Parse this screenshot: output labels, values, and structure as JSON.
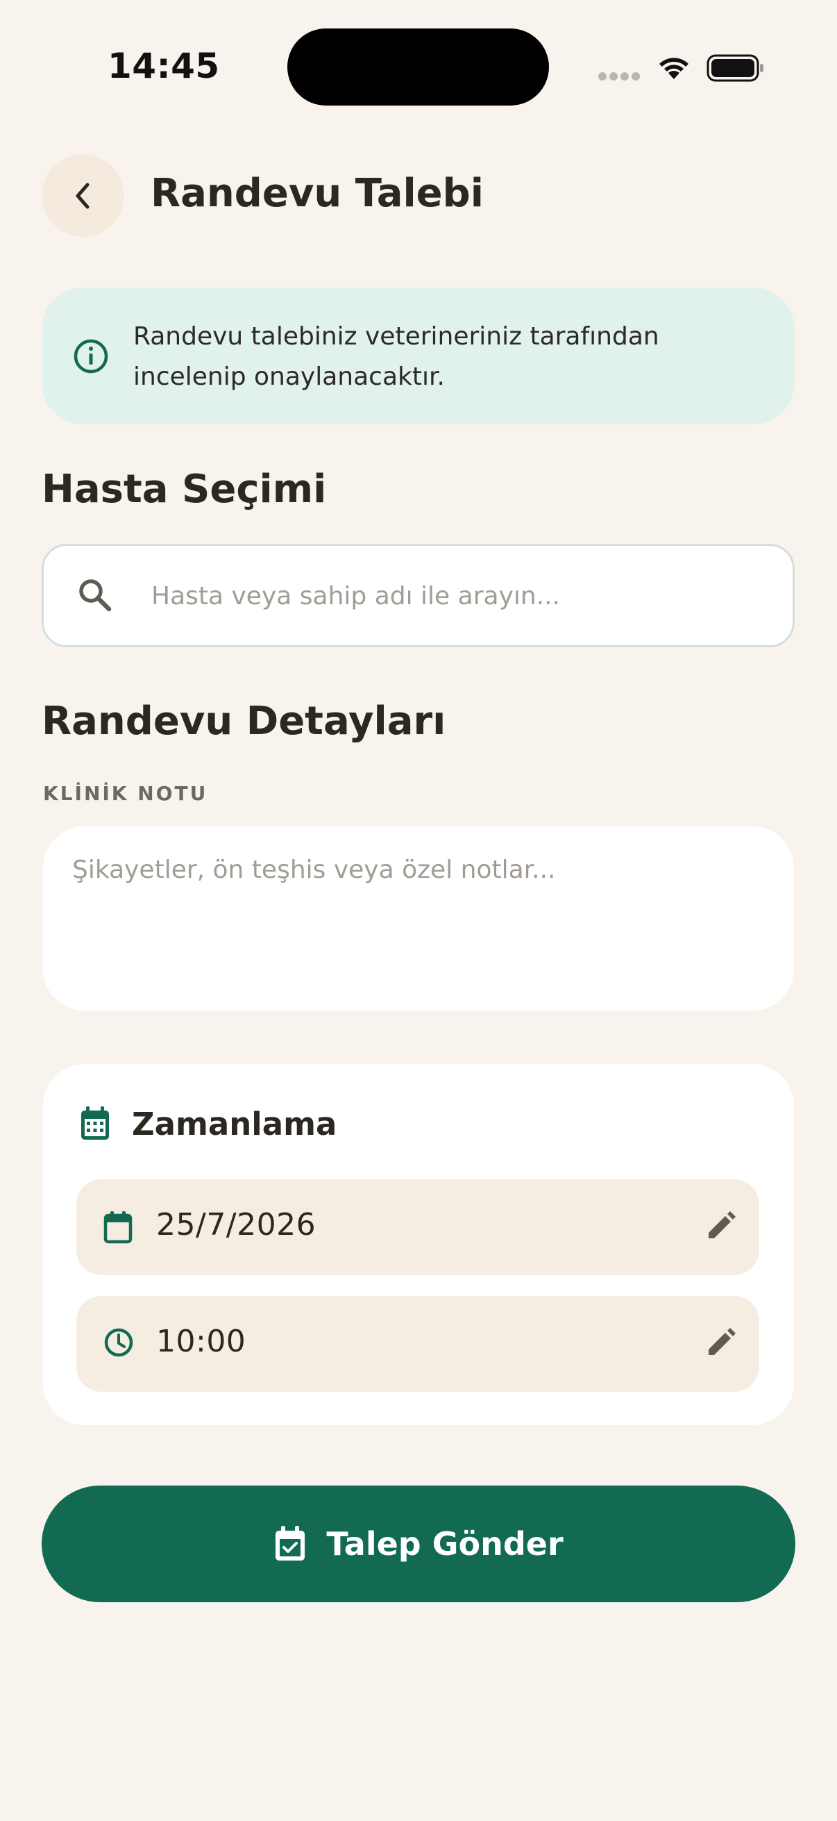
{
  "status_bar": {
    "time": "14:45",
    "icons": [
      "cellular-signal-icon",
      "wifi-icon",
      "battery-icon"
    ]
  },
  "header": {
    "back_icon": "chevron-left-icon",
    "title": "Randevu Talebi"
  },
  "info_banner": {
    "icon": "info-circle-icon",
    "text": "Randevu talebiniz veterineriniz tarafından incelenip onaylanacaktır."
  },
  "patient_section": {
    "title": "Hasta Seçimi",
    "search": {
      "icon": "search-icon",
      "value": "",
      "placeholder": "Hasta veya sahip adı ile arayın..."
    }
  },
  "details_section": {
    "title": "Randevu Detayları",
    "note_label": "KLİNİK NOTU",
    "note": {
      "value": "",
      "placeholder": "Şikayetler, ön teşhis veya özel notlar..."
    }
  },
  "scheduling": {
    "icon": "calendar-grid-icon",
    "title": "Zamanlama",
    "date": {
      "icon": "calendar-icon",
      "value": "25/7/2026",
      "edit_icon": "pencil-icon"
    },
    "time": {
      "icon": "clock-icon",
      "value": "10:00",
      "edit_icon": "pencil-icon"
    }
  },
  "submit": {
    "icon": "calendar-check-icon",
    "label": "Talep Gönder"
  },
  "colors": {
    "background": "#f8f4ed",
    "primary": "#116a51",
    "banner": "#e0f2eb",
    "picker": "#f5ede1",
    "text": "#2b2721"
  }
}
